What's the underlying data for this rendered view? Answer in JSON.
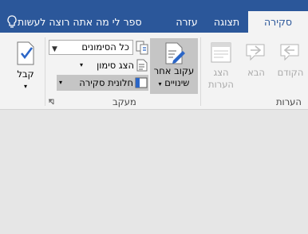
{
  "tabs": {
    "review": "סקירה",
    "view": "תצוגה",
    "help": "עזרה"
  },
  "tell_me": "ספר לי מה אתה רוצה לעשות",
  "comments_group": {
    "label": "הערות",
    "previous": "הקודם",
    "next": "הבא",
    "show_comments_line1": "הצג",
    "show_comments_line2": "הערות"
  },
  "tracking_group": {
    "label": "מעקב",
    "track_changes_line1": "עקוב אחר",
    "track_changes_line2": "שינויים",
    "markup_dropdown": "כל הסימונים",
    "show_markup": "הצג סימון",
    "reviewing_pane": "חלונית סקירה"
  },
  "accept": "קבל",
  "colors": {
    "tab_bar": "#2b579a",
    "ribbon": "#f3f3f3",
    "highlight": "#c5c5c5",
    "canvas": "#e6e6e6"
  }
}
